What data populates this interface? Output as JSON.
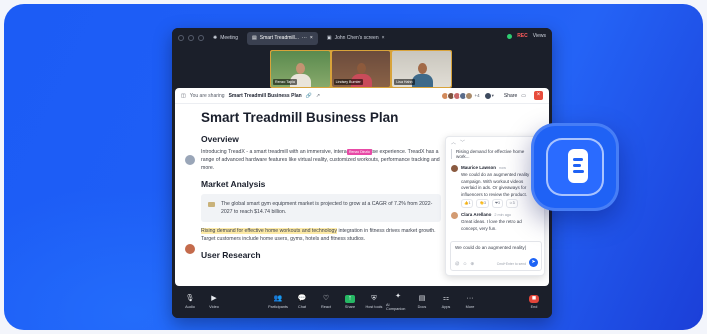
{
  "window": {
    "tabs": [
      {
        "label": "Meeting"
      },
      {
        "label": "Smart Treadmill..."
      },
      {
        "label": "John Chen's screen"
      }
    ],
    "rec_label": "REC",
    "views_label": "Views"
  },
  "participants": [
    {
      "name": "Renzo Tapia"
    },
    {
      "name": "Lindsey Burnier"
    },
    {
      "name": "Lisa Hahn"
    }
  ],
  "docbar": {
    "sharing_prefix": "You are sharing",
    "doc_name": "Smart Treadmill Business Plan",
    "extra_count": "+4",
    "share_label": "Share"
  },
  "doc": {
    "title": "Smart Treadmill Business Plan",
    "overview_heading": "Overview",
    "overview_text": "Introducing TreadX - a smart treadmill with an immersive, interactive exercise experience. TreadX has a range of advanced hardware features like virtual reality, customized workouts, performance tracking and more.",
    "cursor_tag": "Renzo Dinzio",
    "market_heading": "Market Analysis",
    "market_quote": "The global smart gym equipment market is projected to grow at a CAGR of 7.2% from 2022-2027 to reach $14.74 billion.",
    "market_highlight": "Rising demand for effective home workouts and technology",
    "market_text": " integration in fitness drives market growth. Target customers include home users, gyms, hotels and fitness studios.",
    "research_heading": "User Research"
  },
  "comments": {
    "quoted": "Rising demand for effective home work...",
    "items": [
      {
        "author": "Maurice Lawson",
        "time": "now",
        "text": "We could do an augmented reality campaign. With workout videos overlaid in ads. Or giveaways for influencers to review the product.",
        "reactions": [
          "1",
          "3",
          "3",
          "3"
        ]
      },
      {
        "author": "Clara Arellano",
        "time": "2 min ago",
        "text": "Great ideas. I love the retro ad concept, very fun."
      }
    ],
    "reply_text": "We could do an augmented reality|",
    "reply_hint": "Cmd+Enter to send"
  },
  "toolbar": {
    "items": [
      "Audio",
      "Video",
      "Participants",
      "Chat",
      "React",
      "Share",
      "Host tools",
      "AI Companion",
      "Docs",
      "Apps",
      "More"
    ],
    "end_label": "End"
  },
  "colors": {
    "background": "#1f5ff7",
    "accent": "#1d63f5",
    "highlight": "#fdeaa6",
    "end": "#e2453a",
    "share": "#26b864"
  }
}
